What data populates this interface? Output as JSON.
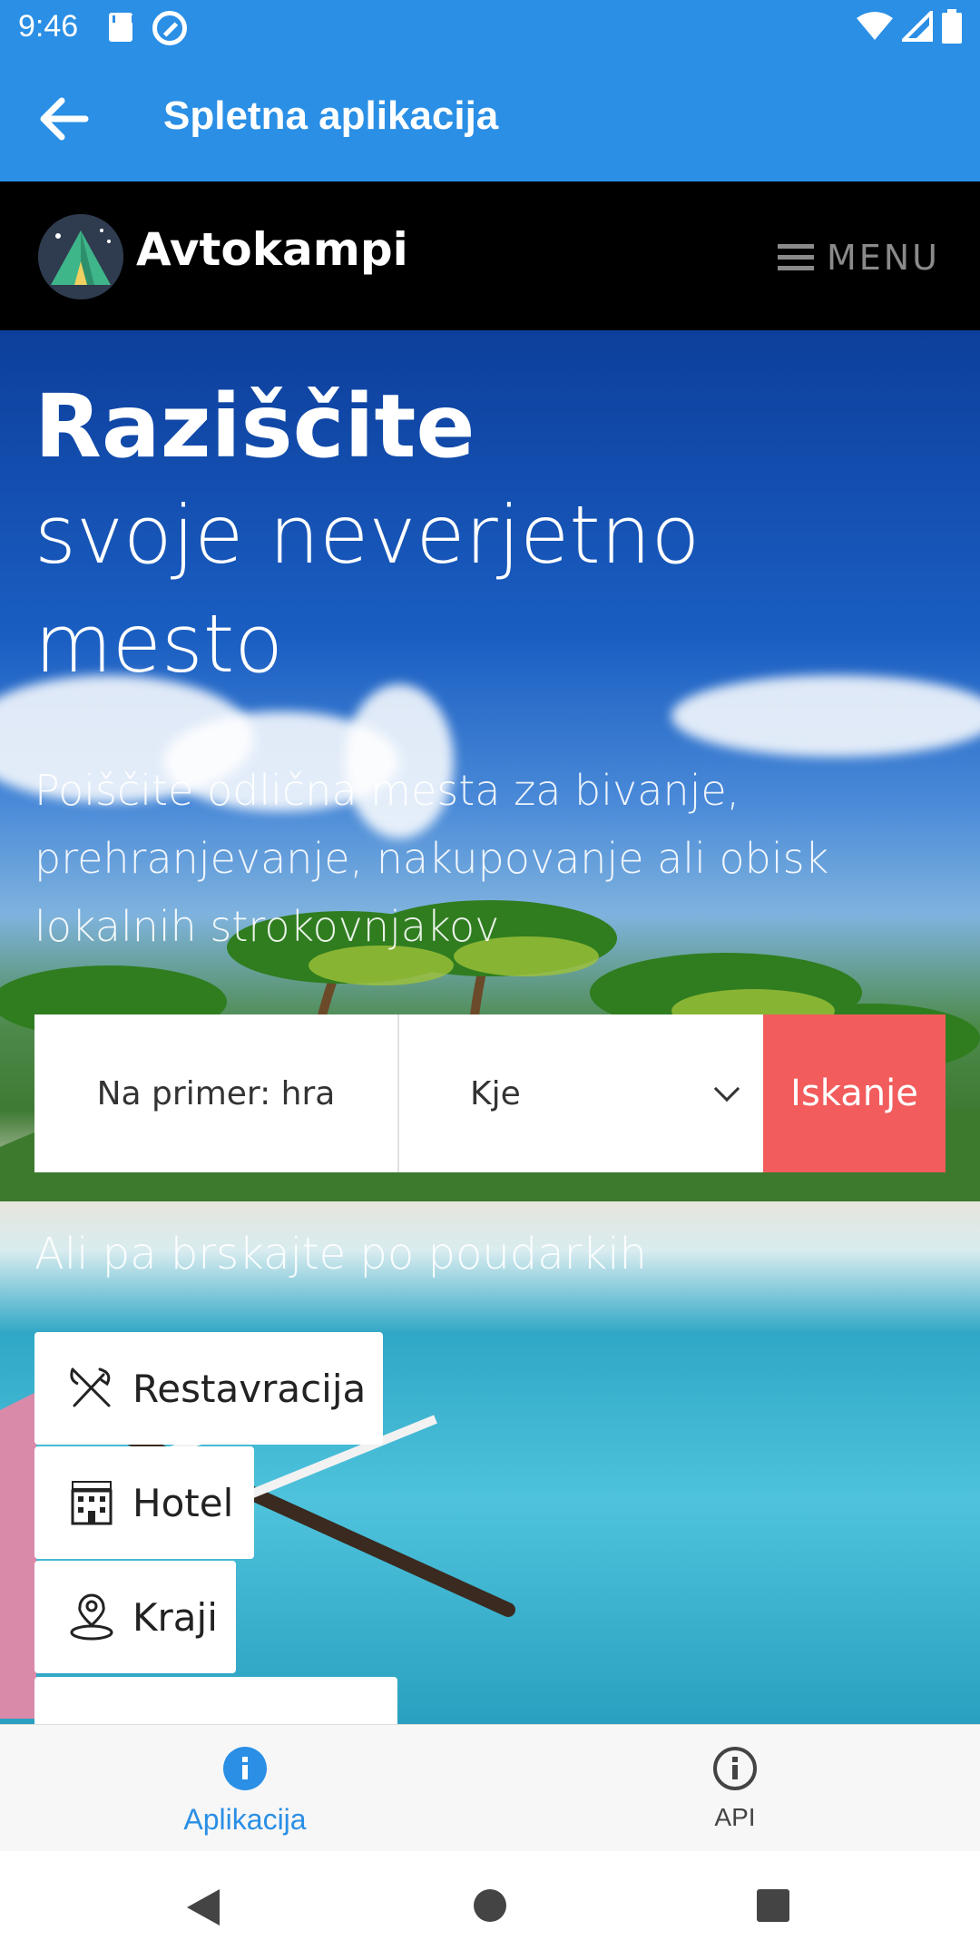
{
  "status_bar": {
    "time": "9:46"
  },
  "app_bar": {
    "title": "Spletna aplikacija",
    "back_icon": "arrow-left-icon"
  },
  "site": {
    "brand": "Avtokampi",
    "menu_label": "MENU",
    "menu_icon": "hamburger-icon"
  },
  "hero": {
    "title": "Raziščite",
    "subtitle": "svoje neverjetno mesto",
    "description": "Poiščite odlična mesta za bivanje, prehranjevanje, nakupovanje ali obisk lokalnih strokovnjakov",
    "search_placeholder": "Na primer: hra",
    "where_label": "Kje",
    "search_button": "Iskanje",
    "browse_label": "Ali pa brskajte po poudarkih",
    "accent_color": "#f25c5c"
  },
  "categories": [
    {
      "label": "Restavracija",
      "icon": "fork-knife-icon"
    },
    {
      "label": "Hotel",
      "icon": "hotel-icon"
    },
    {
      "label": "Kraji",
      "icon": "map-pin-icon"
    }
  ],
  "bottom_nav": {
    "items": [
      {
        "label": "Aplikacija",
        "icon": "info-filled-icon",
        "active": true
      },
      {
        "label": "API",
        "icon": "info-outline-icon",
        "active": false
      }
    ]
  },
  "colors": {
    "primary": "#2a8fe5"
  }
}
